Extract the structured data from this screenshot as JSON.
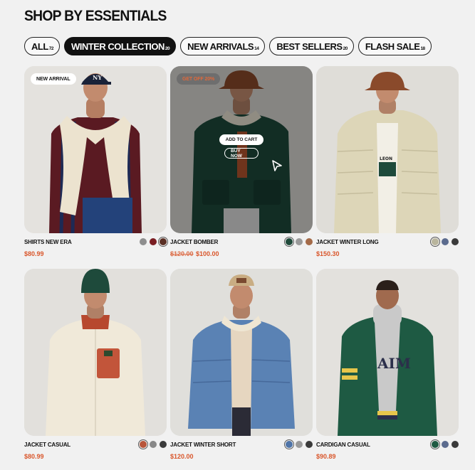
{
  "title": "SHOP BY ESSENTIALS",
  "filters": [
    {
      "label": "ALL",
      "count": "72"
    },
    {
      "label": "WINTER COLLECTION",
      "count": "20"
    },
    {
      "label": "NEW ARRIVALS",
      "count": "14"
    },
    {
      "label": "BEST SELLERS",
      "count": "20"
    },
    {
      "label": "FLASH SALE",
      "count": "18"
    }
  ],
  "active_filter": "WINTER COLLECTION",
  "products": [
    {
      "name": "SHIRTS NEW ERA",
      "price": "$80.99",
      "badge": "NEW ARRIVAL",
      "swatches": [
        "#8e8e8e",
        "#7a1d22",
        "#5a2f24"
      ],
      "selected_swatch": 2
    },
    {
      "name": "JACKET BOMBER",
      "old_price": "$120.00",
      "price": "$100.00",
      "badge": "GET OFF 20%",
      "swatches": [
        "#1f4a3a",
        "#9a9a9a",
        "#a46a48"
      ],
      "selected_swatch": 0,
      "hover": {
        "add_to_cart": "ADD TO CART",
        "buy_now": "BUY NOW"
      }
    },
    {
      "name": "JACKET WINTER LONG",
      "price": "$150.30",
      "swatches": [
        "#b9b59d",
        "#5b6b8e",
        "#3a3a3a"
      ],
      "selected_swatch": 0
    },
    {
      "name": "JACKET CASUAL",
      "price": "$80.99",
      "swatches": [
        "#b8553a",
        "#888888",
        "#3a3a3a"
      ],
      "selected_swatch": 0
    },
    {
      "name": "JACKET WINTER SHORT",
      "price": "$120.00",
      "swatches": [
        "#4f74a8",
        "#9a9a9a",
        "#3a3a3a"
      ],
      "selected_swatch": 0
    },
    {
      "name": "CARDIGAN CASUAL",
      "price": "$90.89",
      "swatches": [
        "#1f5a43",
        "#5b6b8e",
        "#3a3a3a"
      ],
      "selected_swatch": 0
    }
  ],
  "colors": {
    "accent_price": "#d9562b",
    "active_chip": "#111111",
    "background": "#f1f1f1"
  },
  "icons": {
    "cursor": "cursor-arrow-icon"
  }
}
